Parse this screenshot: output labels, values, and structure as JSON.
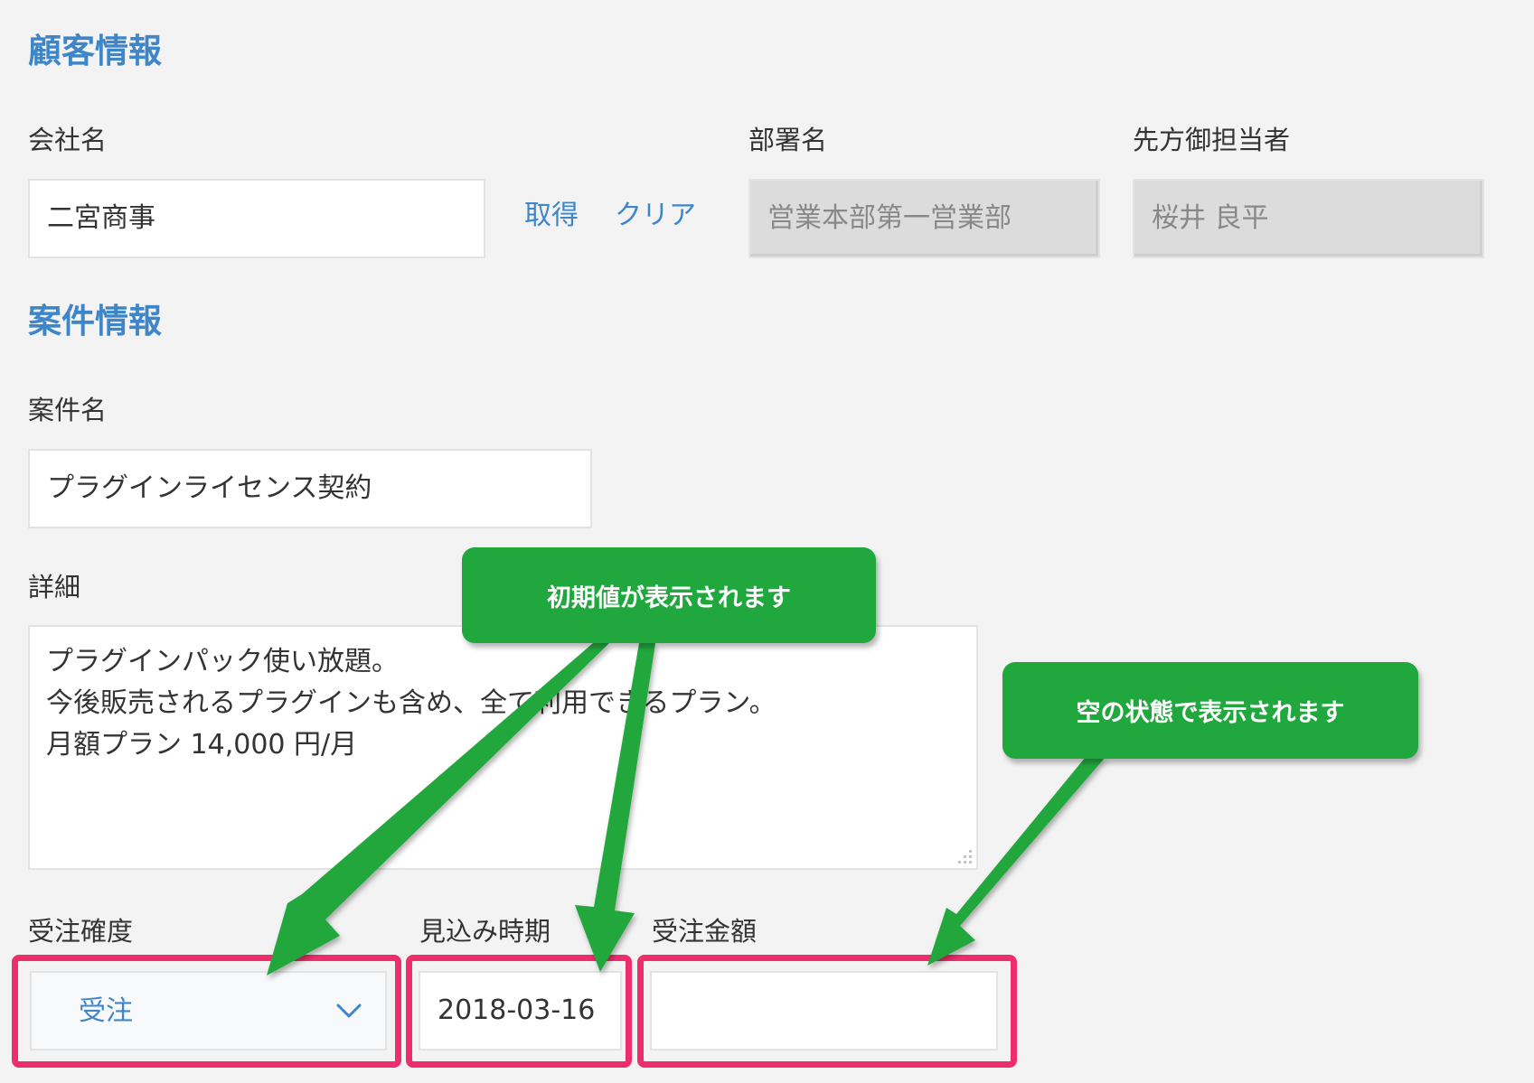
{
  "customer_section": {
    "title": "顧客情報",
    "company_label": "会社名",
    "company_value": "二宮商事",
    "fetch_label": "取得",
    "clear_label": "クリア",
    "department_label": "部署名",
    "department_value": "営業本部第一営業部",
    "contact_label": "先方御担当者",
    "contact_value": "桜井 良平"
  },
  "deal_section": {
    "title": "案件情報",
    "deal_name_label": "案件名",
    "deal_name_value": "プラグインライセンス契約",
    "details_label": "詳細",
    "details_lines": [
      "プラグインパック使い放題。",
      "今後販売されるプラグインも含め、全て利用できるプラン。",
      "月額プラン 14,000 円/月"
    ],
    "probability_label": "受注確度",
    "probability_value": "受注",
    "expected_date_label": "見込み時期",
    "expected_date_value": "2018-03-16",
    "amount_label": "受注金額",
    "amount_value": ""
  },
  "annotations": {
    "initial_value_callout": "初期値が表示されます",
    "empty_state_callout": "空の状態で表示されます",
    "callout_color": "#20a73e",
    "highlight_color": "#ee2e6c"
  },
  "icons": {
    "select_arrow": "chevron-down-icon",
    "resize_handle": "resize-grip-icon"
  },
  "colors": {
    "background": "#f3f3f3",
    "accent": "#3e86c8",
    "readonly_background": "#dcdcdc"
  }
}
